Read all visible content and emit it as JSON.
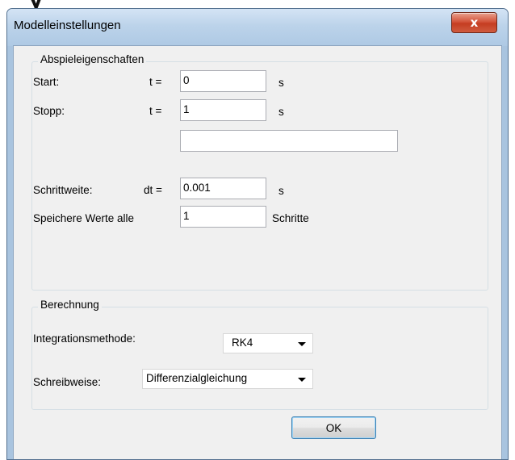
{
  "window": {
    "title": "Modelleinstellungen",
    "close_glyph": "x"
  },
  "playback": {
    "group_title": "Abspieleigenschaften",
    "start_label": "Start:",
    "start_var": "t =",
    "start_value": "0",
    "start_unit": "s",
    "stop_label": "Stopp:",
    "stop_var": "t =",
    "stop_value": "1",
    "stop_unit": "s",
    "extra_value": "",
    "step_label": "Schrittweite:",
    "step_var": "dt =",
    "step_value": "0.001",
    "step_unit": "s",
    "save_label": "Speichere Werte alle",
    "save_value": "1",
    "save_unit": "Schritte"
  },
  "calculation": {
    "group_title": "Berechnung",
    "method_label": "Integrationsmethode:",
    "method_value": "RK4",
    "notation_label": "Schreibweise:",
    "notation_value": "Differenzialgleichung"
  },
  "ok_label": "OK",
  "colors": {
    "close_button": "#c53d21",
    "title_bar": "#bcd3ea",
    "client_background": "#f0f0f0"
  }
}
